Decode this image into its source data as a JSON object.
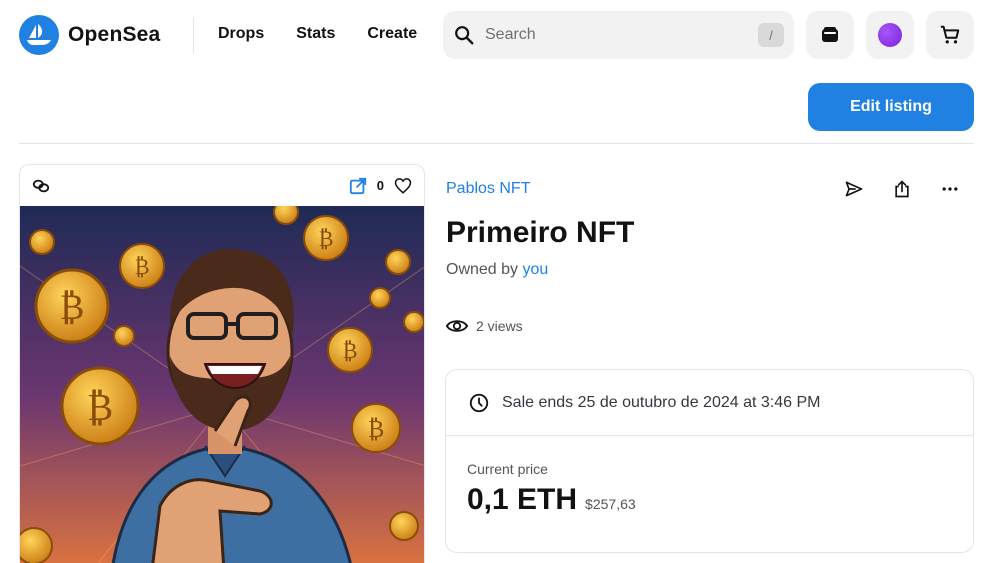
{
  "brand": {
    "name": "OpenSea",
    "accent": "#2081e2"
  },
  "nav": {
    "links": [
      "Drops",
      "Stats",
      "Create"
    ],
    "search_placeholder": "Search",
    "search_shortcut": "/",
    "icons": [
      "wallet-icon",
      "profile-avatar",
      "cart-icon"
    ]
  },
  "toolbar": {
    "edit_listing_label": "Edit listing"
  },
  "card": {
    "favorite_count": "0"
  },
  "item": {
    "collection": "Pablos NFT",
    "title": "Primeiro NFT",
    "owned_by_prefix": "Owned by",
    "owner": "you",
    "views": "2 views"
  },
  "sale": {
    "ends_text": "Sale ends 25 de outubro de 2024 at 3:46 PM",
    "price_label": "Current price",
    "price": "0,1 ETH",
    "price_usd": "$257,63"
  }
}
